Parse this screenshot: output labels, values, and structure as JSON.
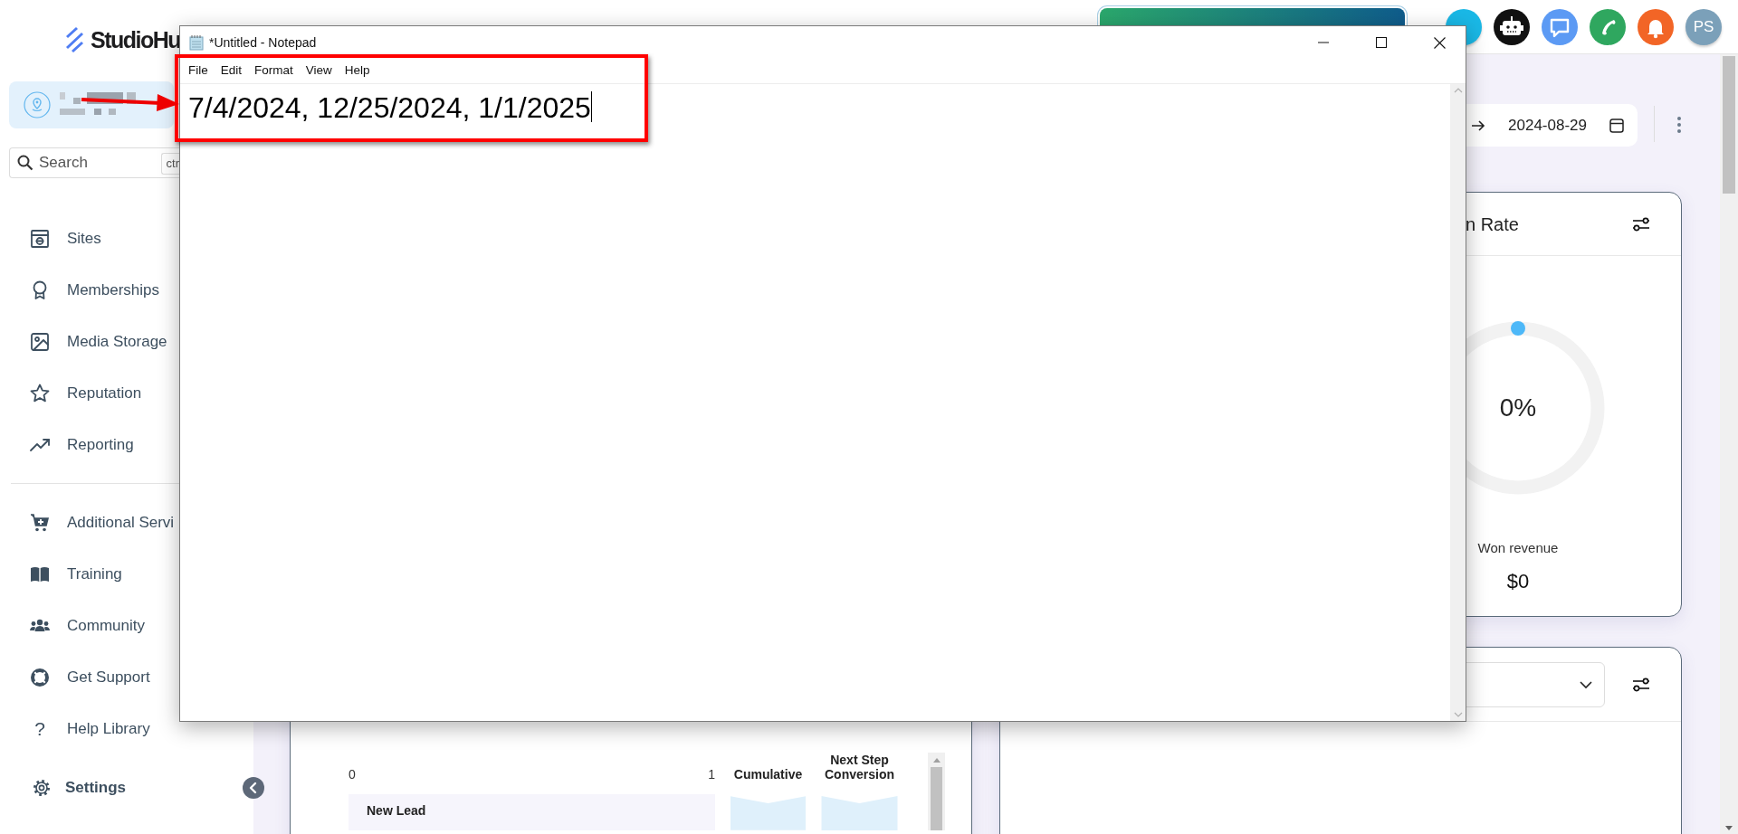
{
  "logo": {
    "text": "StudioHu"
  },
  "header": {
    "avatar": "PS"
  },
  "sidebar": {
    "search": {
      "placeholder": "Search",
      "shortcut": "ctr"
    },
    "sections": [
      {
        "items": [
          {
            "label": "Sites"
          },
          {
            "label": "Memberships"
          },
          {
            "label": "Media Storage"
          },
          {
            "label": "Reputation"
          },
          {
            "label": "Reporting"
          }
        ]
      },
      {
        "items": [
          {
            "label": "Additional Servi"
          },
          {
            "label": "Training"
          },
          {
            "label": "Community"
          },
          {
            "label": "Get Support"
          },
          {
            "label": "Help Library",
            "glyph": "?"
          }
        ]
      }
    ],
    "settings": "Settings"
  },
  "date_range": {
    "end": "2024-08-29"
  },
  "win_rate_card": {
    "title": "n Rate",
    "value_label": "0%",
    "footer_label": "Won revenue",
    "footer_value": "$0"
  },
  "funnel_card": {
    "axis": [
      "0",
      "1"
    ],
    "columns": [
      "Cumulative",
      "Next Step Conversion"
    ],
    "rows": [
      {
        "label": "New Lead"
      }
    ]
  },
  "notepad": {
    "title": "*Untitled - Notepad",
    "menu": [
      "File",
      "Edit",
      "Format",
      "View",
      "Help"
    ],
    "text": "7/4/2024, 12/25/2024, 1/1/2025"
  }
}
